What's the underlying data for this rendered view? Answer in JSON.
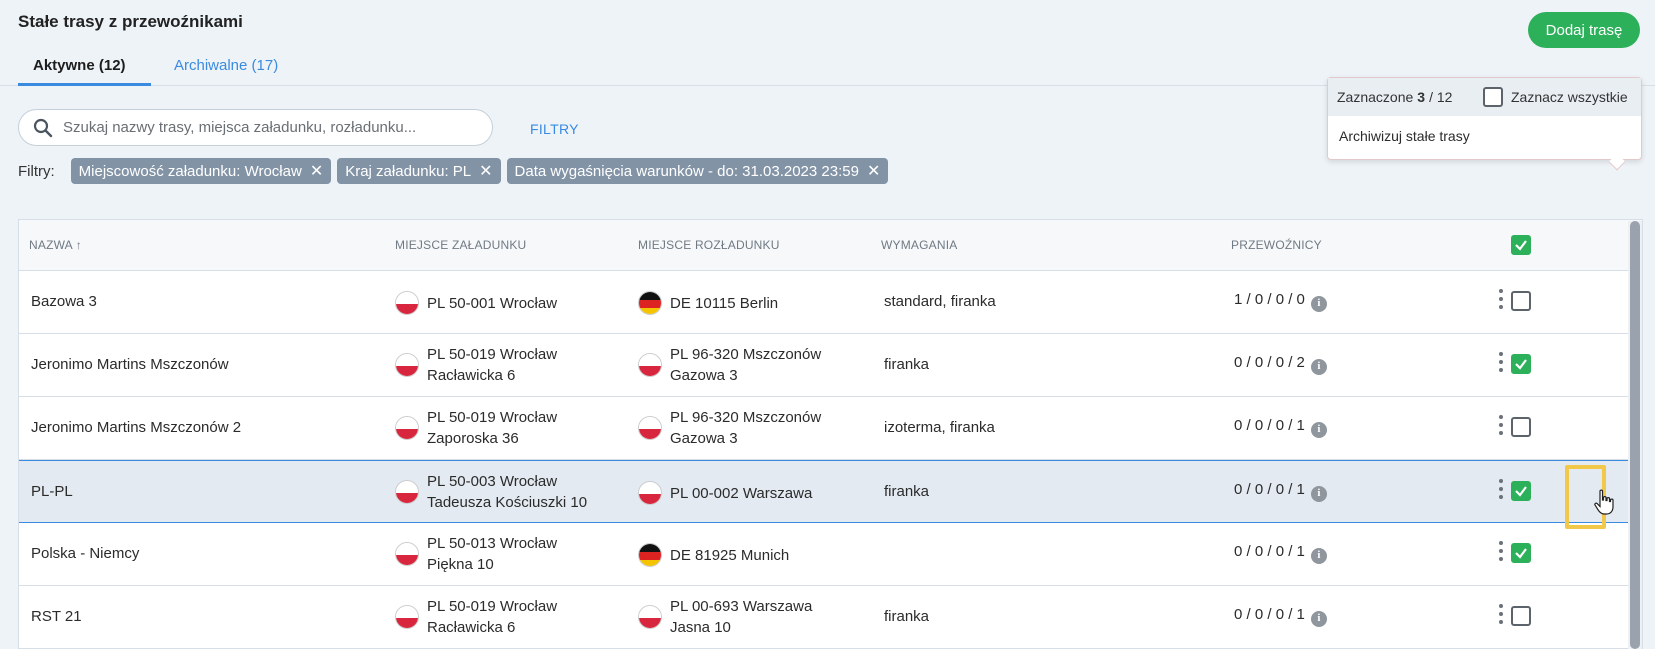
{
  "header": {
    "title": "Stałe trasy z przewoźnikami",
    "add_button": "Dodaj trasę",
    "tabs": [
      {
        "label": "Aktywne (12)",
        "active": true
      },
      {
        "label": "Archiwalne (17)",
        "active": false
      }
    ]
  },
  "search": {
    "placeholder": "Szukaj nazwy trasy, miejsca załadunku, rozładunku...",
    "filters_link": "FILTRY"
  },
  "filters": {
    "label": "Filtry:",
    "chips": [
      "Miejscowość załadunku: Wrocław",
      "Kraj załadunku: PL",
      "Data wygaśnięcia warunków - do: 31.03.2023 23:59"
    ]
  },
  "popup": {
    "selected_prefix": "Zaznaczone",
    "selected_count": "3",
    "selected_total": "/ 12",
    "select_all": "Zaznacz wszystkie",
    "archive_action": "Archiwizuj stałe trasy"
  },
  "table": {
    "columns": {
      "name": "NAZWA",
      "loading": "MIEJSCE ZAŁADUNKU",
      "unloading": "MIEJSCE ROZŁADUNKU",
      "requirements": "WYMAGANIA",
      "carriers": "PRZEWOŹNICY"
    },
    "sort_indicator": "↑",
    "header_checkbox_checked": true,
    "rows": [
      {
        "name": "Bazowa 3",
        "loading_flag": "pl",
        "loading_line1": "PL 50-001 Wrocław",
        "loading_line2": "",
        "unloading_flag": "de",
        "unloading_line1": "DE 10115 Berlin",
        "unloading_line2": "",
        "requirements": "standard, firanka",
        "carriers": "1 / 0 / 0 / 0",
        "checked": false
      },
      {
        "name": "Jeronimo Martins Mszczonów",
        "loading_flag": "pl",
        "loading_line1": "PL 50-019 Wrocław",
        "loading_line2": "Racławicka 6",
        "unloading_flag": "pl",
        "unloading_line1": "PL 96-320 Mszczonów",
        "unloading_line2": "Gazowa 3",
        "requirements": "firanka",
        "carriers": "0 / 0 / 0 / 2",
        "checked": true
      },
      {
        "name": "Jeronimo Martins Mszczonów 2",
        "loading_flag": "pl",
        "loading_line1": "PL 50-019 Wrocław",
        "loading_line2": "Zaporoska 36",
        "unloading_flag": "pl",
        "unloading_line1": "PL 96-320 Mszczonów",
        "unloading_line2": "Gazowa 3",
        "requirements": "izoterma, firanka",
        "carriers": "0 / 0 / 0 / 1",
        "checked": false
      },
      {
        "name": "PL-PL",
        "loading_flag": "pl",
        "loading_line1": "PL 50-003 Wrocław",
        "loading_line2": "Tadeusza Kościuszki 10",
        "unloading_flag": "pl",
        "unloading_line1": "PL 00-002 Warszawa",
        "unloading_line2": "",
        "requirements": "firanka",
        "carriers": "0 / 0 / 0 / 1",
        "checked": true
      },
      {
        "name": "Polska - Niemcy",
        "loading_flag": "pl",
        "loading_line1": "PL 50-013 Wrocław",
        "loading_line2": "Piękna 10",
        "unloading_flag": "de",
        "unloading_line1": "DE 81925 Munich",
        "unloading_line2": "",
        "requirements": "",
        "carriers": "0 / 0 / 0 / 1",
        "checked": true
      },
      {
        "name": "RST 21",
        "loading_flag": "pl",
        "loading_line1": "PL 50-019 Wrocław",
        "loading_line2": "Racławicka 6",
        "unloading_flag": "pl",
        "unloading_line1": "PL 00-693 Warszawa",
        "unloading_line2": "Jasna 10",
        "requirements": "firanka",
        "carriers": "0 / 0 / 0 / 1",
        "checked": false
      }
    ]
  },
  "colors": {
    "accent_blue": "#3a8be0",
    "green": "#2db05a",
    "chip_gray": "#8293a6",
    "highlight_yellow": "#f2c84b"
  }
}
